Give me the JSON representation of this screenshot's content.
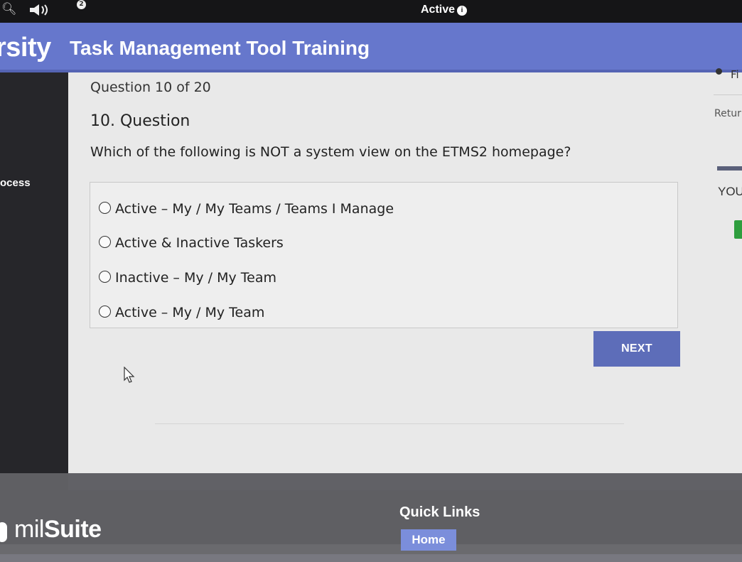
{
  "topbar": {
    "search_icon": "search-icon",
    "speaker_icon": "speaker-icon",
    "notification_count": "2",
    "status_label": "Active",
    "status_info_glyph": "i"
  },
  "header": {
    "brand_fragment": "rsity",
    "title": "Task Management Tool Training",
    "color": "#6677cc"
  },
  "left_panel": {
    "fragment": "ocess"
  },
  "question": {
    "counter": "Question 10 of 20",
    "heading": "10. Question",
    "text": "Which of the following is NOT a system view on the ETMS2 homepage?",
    "options": [
      {
        "label": "Active – My / My Teams / Teams I Manage"
      },
      {
        "label": "Active & Inactive Taskers"
      },
      {
        "label": "Inactive – My / My Team"
      },
      {
        "label": "Active – My / My Team"
      }
    ],
    "selected": null
  },
  "next_button": {
    "label": "NEXT",
    "color": "#5d6db9"
  },
  "right_panel": {
    "fragment_top": "Fi",
    "fragment_return": "Retur",
    "fragment_you": "YOU",
    "accent_green": "#2e9e3e"
  },
  "footer": {
    "logo_text_light": "mil",
    "logo_text_bold": "Suite",
    "quick_links_heading": "Quick Links",
    "home_button": "Home",
    "home_button_color": "#7b8edb"
  }
}
